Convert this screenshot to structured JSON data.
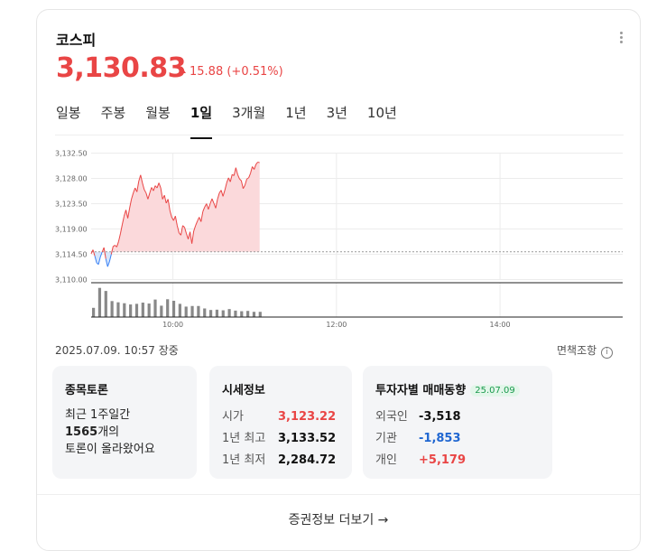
{
  "title": "코스피",
  "price": "3,130.83",
  "change": "15.88 (+0.51%)",
  "tabs": [
    "일봉",
    "주봉",
    "월봉",
    "1일",
    "3개월",
    "1년",
    "3년",
    "10년"
  ],
  "active_tab": "1일",
  "timestamp": "2025.07.09. 10:57 장중",
  "disclaimer": "면책조항",
  "forum": {
    "title": "종목토론",
    "line1": "최근 1주일간",
    "count": "1565",
    "count_suffix": "개의",
    "line3": "토론이 올라왔어요"
  },
  "quote": {
    "title": "시세정보",
    "rows": [
      {
        "label": "시가",
        "value": "3,123.22",
        "color": "#e94545"
      },
      {
        "label": "1년 최고",
        "value": "3,133.52",
        "color": "#111111"
      },
      {
        "label": "1년 최저",
        "value": "2,284.72",
        "color": "#111111"
      }
    ]
  },
  "investor": {
    "title": "투자자별 매매동향",
    "date": "25.07.09",
    "rows": [
      {
        "label": "외국인",
        "value": "-3,518",
        "color": "#111111"
      },
      {
        "label": "기관",
        "value": "-1,853",
        "color": "#1f66d1"
      },
      {
        "label": "개인",
        "value": "+5,179",
        "color": "#e94545"
      }
    ]
  },
  "footer_link": "증권정보 더보기 →",
  "chart_data": {
    "type": "line",
    "y_ticks": [
      "3,132.50",
      "3,128.00",
      "3,123.50",
      "3,119.00",
      "3,114.50",
      "3,110.00"
    ],
    "x_ticks": [
      "10:00",
      "12:00",
      "14:00"
    ],
    "ylim": [
      3110.0,
      3132.5
    ],
    "baseline": 3114.95,
    "x_range": [
      "09:00",
      "15:30"
    ],
    "price_series": [
      [
        0,
        3114.6
      ],
      [
        1,
        3115.3
      ],
      [
        2,
        3114.2
      ],
      [
        3,
        3113.0
      ],
      [
        4,
        3112.7
      ],
      [
        5,
        3114.0
      ],
      [
        6,
        3114.9
      ],
      [
        7,
        3115.7
      ],
      [
        8,
        3113.7
      ],
      [
        9,
        3112.3
      ],
      [
        10,
        3113.2
      ],
      [
        11,
        3114.5
      ],
      [
        12,
        3115.9
      ],
      [
        13,
        3116.1
      ],
      [
        14,
        3115.8
      ],
      [
        15,
        3116.8
      ],
      [
        16,
        3118.2
      ],
      [
        17,
        3119.8
      ],
      [
        18,
        3121.3
      ],
      [
        19,
        3122.4
      ],
      [
        20,
        3120.9
      ],
      [
        21,
        3122.7
      ],
      [
        22,
        3124.3
      ],
      [
        23,
        3125.4
      ],
      [
        24,
        3126.3
      ],
      [
        25,
        3125.6
      ],
      [
        26,
        3127.5
      ],
      [
        27,
        3128.6
      ],
      [
        28,
        3127.2
      ],
      [
        29,
        3126.0
      ],
      [
        30,
        3125.4
      ],
      [
        31,
        3124.3
      ],
      [
        32,
        3125.4
      ],
      [
        33,
        3126.4
      ],
      [
        34,
        3125.8
      ],
      [
        35,
        3126.7
      ],
      [
        36,
        3126.3
      ],
      [
        37,
        3127.2
      ],
      [
        38,
        3126.3
      ],
      [
        39,
        3124.3
      ],
      [
        40,
        3125.0
      ],
      [
        41,
        3123.6
      ],
      [
        42,
        3124.3
      ],
      [
        43,
        3122.3
      ],
      [
        44,
        3121.1
      ],
      [
        45,
        3120.5
      ],
      [
        46,
        3121.3
      ],
      [
        47,
        3119.6
      ],
      [
        48,
        3118.3
      ],
      [
        49,
        3117.9
      ],
      [
        50,
        3119.6
      ],
      [
        51,
        3119.3
      ],
      [
        52,
        3118.2
      ],
      [
        53,
        3117.2
      ],
      [
        54,
        3118.5
      ],
      [
        55,
        3116.4
      ],
      [
        56,
        3118.6
      ],
      [
        57,
        3119.6
      ],
      [
        58,
        3120.4
      ],
      [
        59,
        3121.1
      ],
      [
        60,
        3120.3
      ],
      [
        61,
        3122.1
      ],
      [
        62,
        3122.9
      ],
      [
        63,
        3123.5
      ],
      [
        64,
        3122.5
      ],
      [
        65,
        3123.5
      ],
      [
        66,
        3124.4
      ],
      [
        67,
        3123.6
      ],
      [
        68,
        3122.7
      ],
      [
        69,
        3124.3
      ],
      [
        70,
        3125.4
      ],
      [
        71,
        3125.9
      ],
      [
        72,
        3124.8
      ],
      [
        73,
        3125.9
      ],
      [
        74,
        3127.2
      ],
      [
        75,
        3128.1
      ],
      [
        76,
        3127.4
      ],
      [
        77,
        3128.7
      ],
      [
        78,
        3128.5
      ],
      [
        79,
        3129.9
      ],
      [
        80,
        3128.7
      ],
      [
        81,
        3127.9
      ],
      [
        82,
        3127.6
      ],
      [
        83,
        3126.2
      ],
      [
        84,
        3126.8
      ],
      [
        85,
        3127.9
      ],
      [
        86,
        3128.1
      ],
      [
        87,
        3128.9
      ],
      [
        88,
        3130.1
      ],
      [
        89,
        3129.6
      ],
      [
        90,
        3130.5
      ],
      [
        91,
        3130.9
      ],
      [
        92,
        3130.8
      ]
    ],
    "volume_bars": [
      30,
      95,
      85,
      52,
      48,
      45,
      41,
      43,
      47,
      44,
      57,
      37,
      58,
      53,
      43,
      34,
      36,
      36,
      28,
      23,
      24,
      22,
      26,
      21,
      19,
      20,
      17,
      17
    ]
  }
}
